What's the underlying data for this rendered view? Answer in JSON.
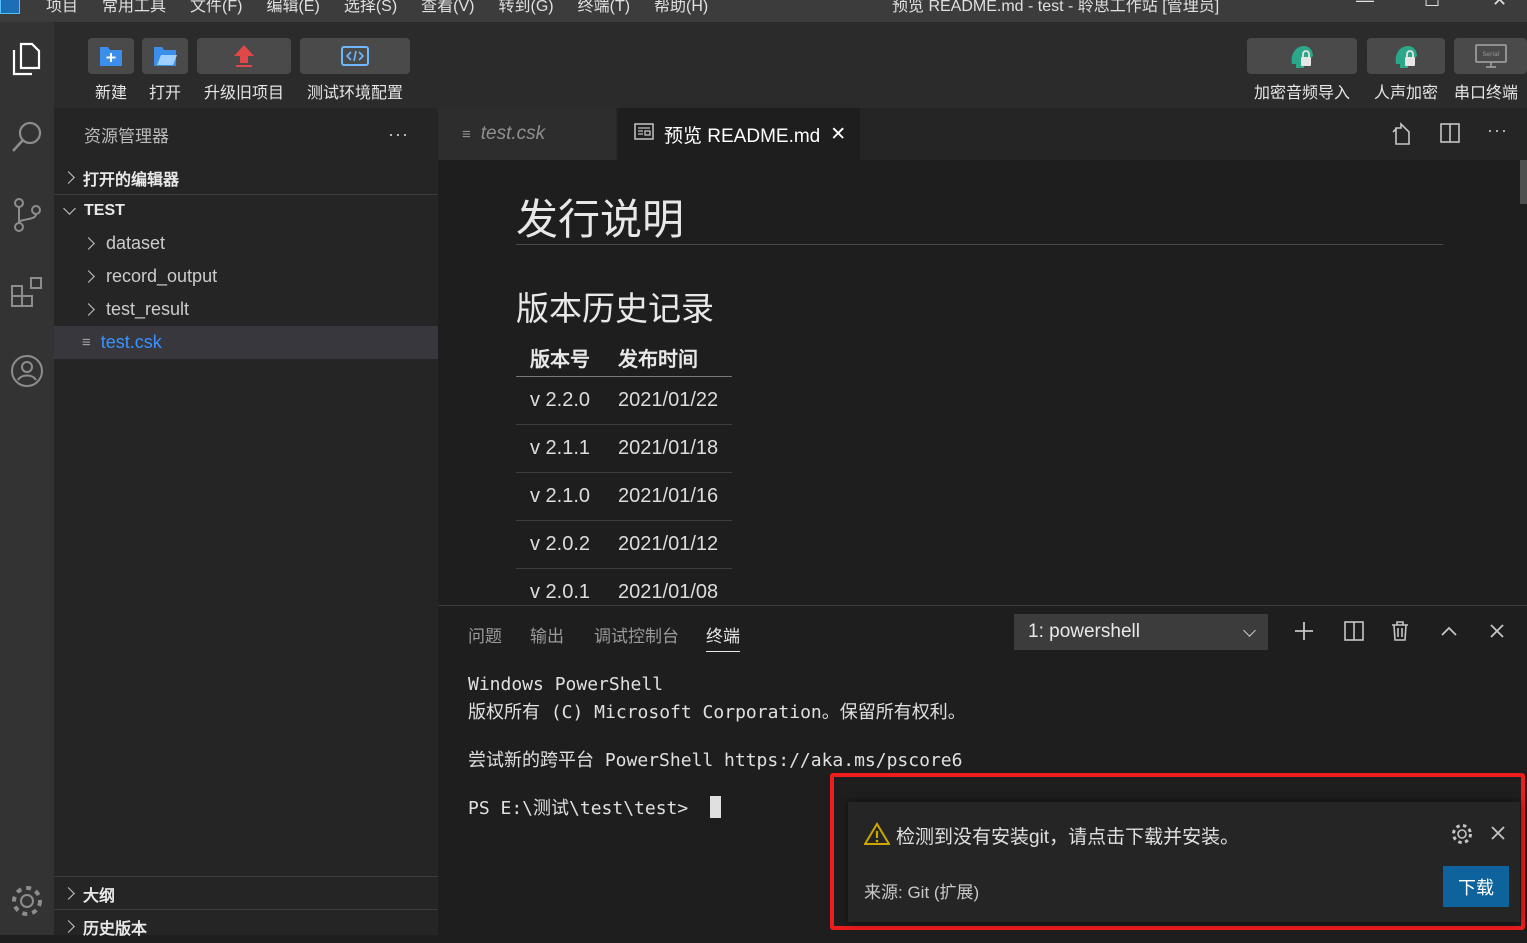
{
  "titlebar": {
    "menu": [
      "项目",
      "常用工具",
      "文件(F)",
      "编辑(E)",
      "选择(S)",
      "查看(V)",
      "转到(G)",
      "终端(T)",
      "帮助(H)"
    ],
    "window_title": "预览 README.md - test - 聆思工作站 [管理员]"
  },
  "toolbar": {
    "left_buttons": [
      {
        "label": "新建",
        "icon": "new-file-icon"
      },
      {
        "label": "打开",
        "icon": "open-folder-icon"
      },
      {
        "label": "升级旧项目",
        "icon": "upgrade-arrow-icon"
      },
      {
        "label": "测试环境配置",
        "icon": "code-config-icon"
      }
    ],
    "right_buttons": [
      {
        "label": "加密音频导入",
        "icon": "lock-head-icon"
      },
      {
        "label": "人声加密",
        "icon": "voice-lock-icon"
      },
      {
        "label": "串口终端",
        "icon": "serial-monitor-icon"
      }
    ],
    "serial_icon_text": "Serial"
  },
  "activity_bar": [
    "explorer-icon",
    "search-icon",
    "source-control-icon",
    "extensions-icon",
    "account-icon",
    "settings-gear-icon"
  ],
  "sidebar": {
    "title": "资源管理器",
    "more": "···",
    "open_editors": "打开的编辑器",
    "project": "TEST",
    "folders": [
      "dataset",
      "record_output",
      "test_result"
    ],
    "selected_file": "test.csk",
    "outline": "大纲",
    "history": "历史版本"
  },
  "tabs": [
    {
      "label": "test.csk",
      "active": false
    },
    {
      "label": "预览 README.md",
      "active": true,
      "close": "✕"
    }
  ],
  "editor": {
    "h1": "发行说明",
    "h2": "版本历史记录",
    "table": {
      "headers": [
        "版本号",
        "发布时间"
      ],
      "rows": [
        [
          "v 2.2.0",
          "2021/01/22"
        ],
        [
          "v 2.1.1",
          "2021/01/18"
        ],
        [
          "v 2.1.0",
          "2021/01/16"
        ],
        [
          "v 2.0.2",
          "2021/01/12"
        ],
        [
          "v 2.0.1",
          "2021/01/08"
        ]
      ]
    }
  },
  "panel": {
    "tabs": [
      "问题",
      "输出",
      "调试控制台",
      "终端"
    ],
    "active_tab": "终端",
    "terminal_select": "1: powershell",
    "terminal_lines": [
      "Windows PowerShell",
      "版权所有 (C) Microsoft Corporation。保留所有权利。",
      "",
      "尝试新的跨平台 PowerShell https://aka.ms/pscore6",
      "",
      "PS E:\\测试\\test\\test> "
    ]
  },
  "notification": {
    "message": "检测到没有安装git，请点击下载并安装。",
    "source": "来源: Git (扩展)",
    "button": "下载",
    "highlight_color": "#ef1d1d"
  },
  "colors": {
    "accent": "#0e639c",
    "selected_file_text": "#3794ff",
    "warning": "#cca700"
  }
}
